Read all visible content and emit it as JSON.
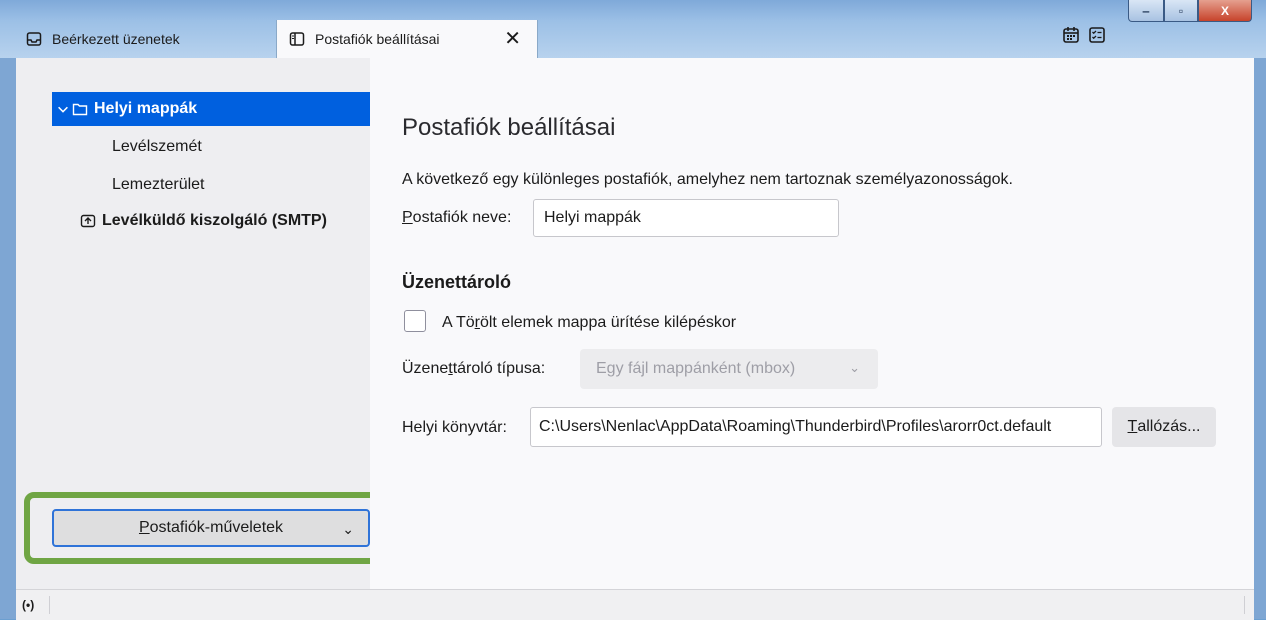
{
  "tabs": [
    {
      "label": "Beérkezett üzenetek",
      "icon": "inbox-icon",
      "active": false
    },
    {
      "label": "Postafiók beállításai",
      "icon": "account-settings-icon",
      "active": true,
      "close": "✕"
    }
  ],
  "toolbar_icons": [
    "calendar-icon",
    "tasks-icon"
  ],
  "window_buttons": {
    "minimize": "‒",
    "maximize": "▫",
    "close": "X"
  },
  "sidebar": {
    "folders": {
      "root": {
        "label": "Helyi mappák",
        "icon": "folder-icon",
        "expanded": true
      },
      "children": [
        {
          "label": "Levélszemét"
        },
        {
          "label": "Lemezterület"
        }
      ],
      "smtp": {
        "label": "Levélküldő kiszolgáló (SMTP)",
        "icon": "smtp-server-icon"
      }
    },
    "actions_button": {
      "label_accel": "P",
      "label_rest": "ostafiók-műveletek",
      "chevron": "⌄"
    }
  },
  "content": {
    "title": "Postafiók beállításai",
    "description": "A következő egy különleges postafiók, amelyhez nem tartoznak személyazonosságok.",
    "account_name": {
      "label_accel": "P",
      "label_rest": "ostafiók neve:",
      "value": "Helyi mappák"
    },
    "message_store": {
      "heading": "Üzenettároló",
      "empty_trash": {
        "label_pre": "A Tö",
        "label_accel": "r",
        "label_post": "ölt elemek mappa ürítése kilépéskor",
        "checked": false
      },
      "store_type": {
        "label_pre": "Üzene",
        "label_accel": "t",
        "label_post": "tároló típusa:",
        "value": "Egy fájl mappánként (mbox)",
        "chevron": "⌄"
      },
      "local_dir": {
        "label": "Helyi könyvtár:",
        "value": "C:\\Users\\Nenlac\\AppData\\Roaming\\Thunderbird\\Profiles\\arorr0ct.default",
        "browse_accel": "T",
        "browse_rest": "allózás..."
      }
    }
  },
  "statusbar": {
    "icon": "online-status-icon",
    "glyph": "(•)"
  },
  "colors": {
    "accent": "#0060df",
    "highlight": "#6fa544"
  }
}
